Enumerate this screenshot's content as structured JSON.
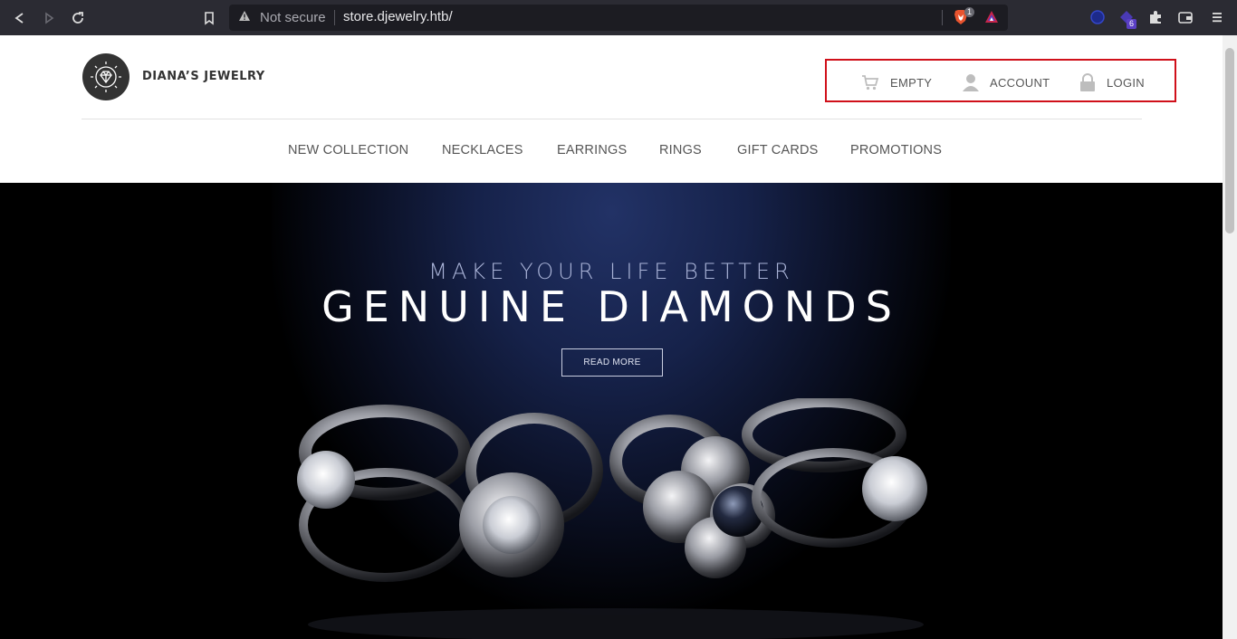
{
  "browser": {
    "url_security_label": "Not secure",
    "url": "store.djewelry.htb/",
    "shield_count": "1",
    "extension_badge": "6"
  },
  "site": {
    "name": "DIANA’S JEWELRY",
    "user_menu": {
      "cart_label": "EMPTY",
      "account_label": "ACCOUNT",
      "login_label": "LOGIN"
    },
    "nav": [
      {
        "label": "NEW COLLECTION"
      },
      {
        "label": "NECKLACES"
      },
      {
        "label": "EARRINGS"
      },
      {
        "label": "RINGS"
      },
      {
        "label": "GIFT CARDS"
      },
      {
        "label": "PROMOTIONS"
      }
    ]
  },
  "hero": {
    "subtitle": "MAKE YOUR LIFE BETTER",
    "title": "GENUINE DIAMONDS",
    "cta_label": "READ MORE"
  },
  "colors": {
    "highlight_border": "#d0101a",
    "chrome_bg": "#2b2b33",
    "hero_accent": "#223266"
  }
}
